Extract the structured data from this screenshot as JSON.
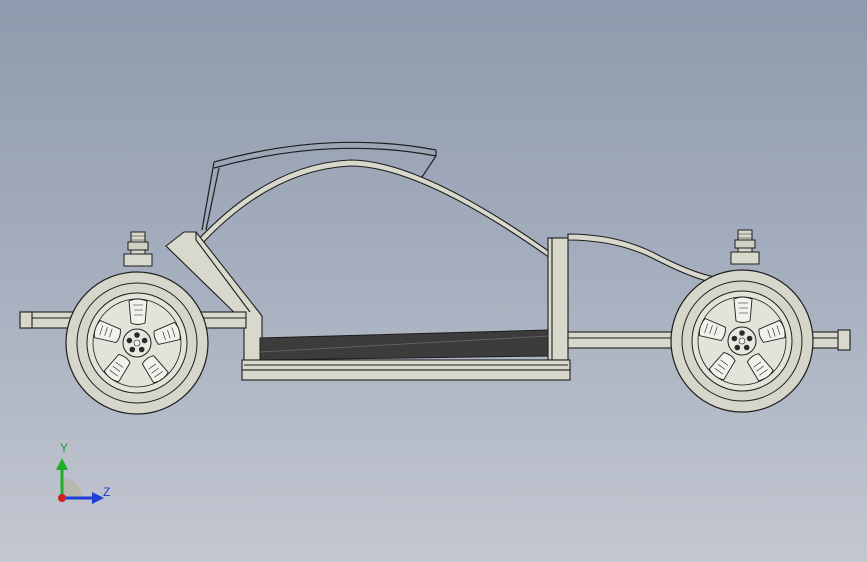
{
  "viewport": {
    "background_top": "#8e9aad",
    "background_bottom": "#c3c7d1"
  },
  "model": {
    "part_fill": "#d8d8cc",
    "part_shade": "#bcbcaf",
    "edge_color": "#1e1e1e",
    "floor_panel_color": "#3c3c3c"
  },
  "triad": {
    "y_label": "Y",
    "z_label": "Z",
    "y_color": "#1fae2b",
    "z_color": "#1f3fd6",
    "x_color": "#d01f1f"
  }
}
